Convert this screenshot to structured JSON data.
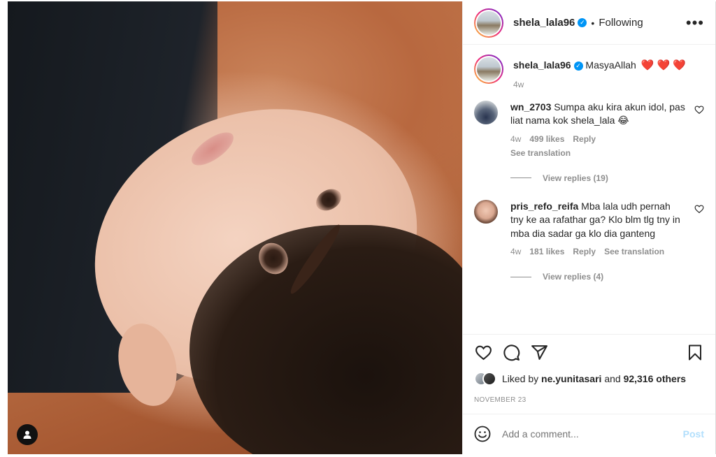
{
  "header": {
    "username": "shela_lala96",
    "separator": "•",
    "following_label": "Following",
    "more_icon": "more-horizontal-icon"
  },
  "caption": {
    "username": "shela_lala96",
    "text": "MasyaAllah",
    "emoji": "❤️ ❤️ ❤️",
    "time": "4w"
  },
  "comments": [
    {
      "username": "wn_2703",
      "text": "Sumpa aku kira akun idol, pas liat nama kok shela_lala 😂",
      "time": "4w",
      "likes": "499 likes",
      "reply_label": "Reply",
      "translation_label": "See translation",
      "view_replies": "View replies (19)"
    },
    {
      "username": "pris_refo_reifa",
      "text": "Mba lala udh pernah tny ke aa rafathar ga? Klo blm tlg tny in mba dia sadar ga klo dia ganteng",
      "time": "4w",
      "likes": "181 likes",
      "reply_label": "Reply",
      "translation_label": "See translation",
      "view_replies": "View replies (4)"
    }
  ],
  "likes": {
    "prefix": "Liked by",
    "user": "ne.yunitasari",
    "middle": "and",
    "others": "92,316 others"
  },
  "date": "NOVEMBER 23",
  "add_comment": {
    "placeholder": "Add a comment...",
    "post_label": "Post"
  },
  "colors": {
    "verified": "#0095f6",
    "heart": "#ed4956",
    "post_disabled": "#b2dffc",
    "muted": "#8e8e8e"
  }
}
